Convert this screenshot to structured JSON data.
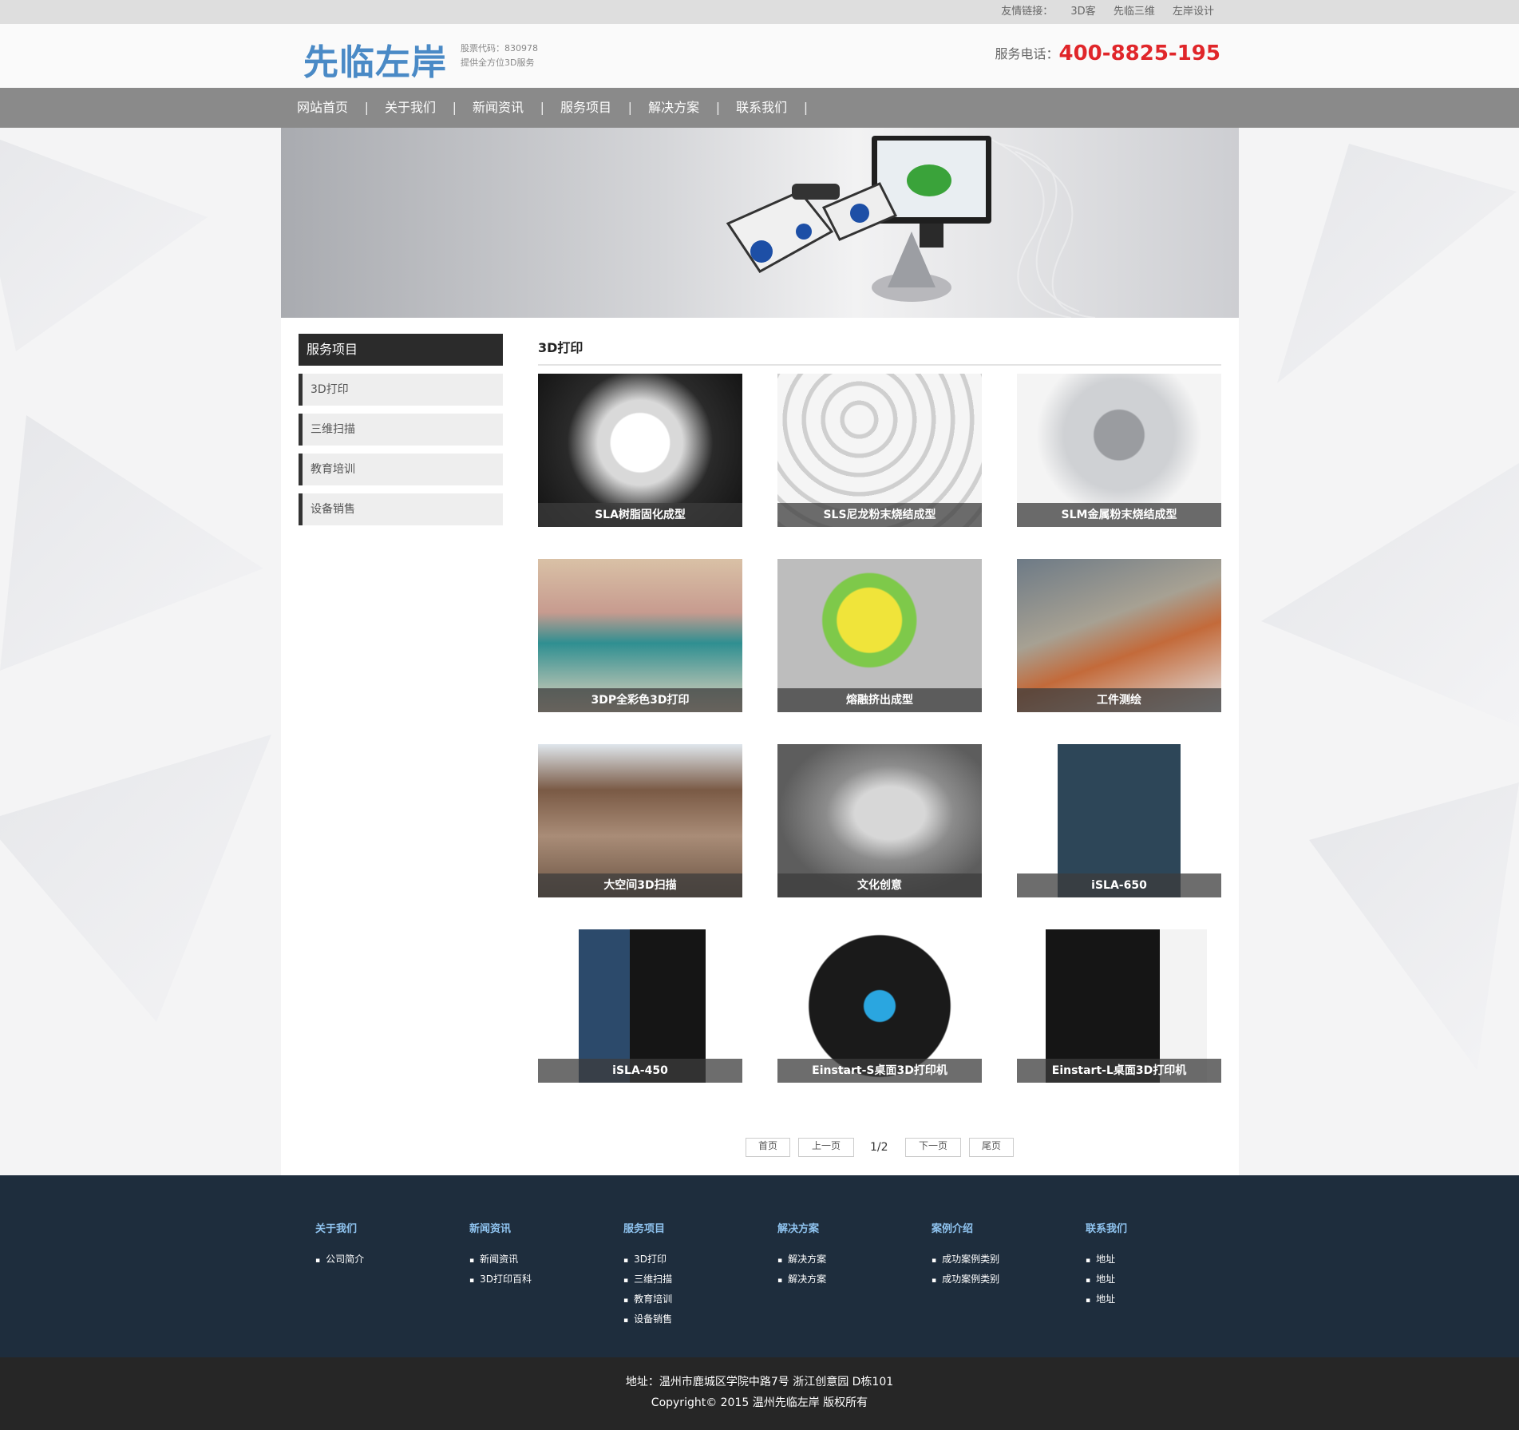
{
  "topbar": {
    "label": "友情链接：",
    "links": [
      "3D客",
      "先临三维",
      "左岸设计"
    ]
  },
  "header": {
    "logo_text": "先临左岸",
    "stock_code": "股票代码：830978",
    "tagline": "提供全方位3D服务",
    "phone_label": "服务电话：",
    "phone_number": "400-8825-195"
  },
  "nav": {
    "items": [
      "网站首页",
      "关于我们",
      "新闻资讯",
      "服务项目",
      "解决方案",
      "联系我们"
    ]
  },
  "sidebar": {
    "title": "服务项目",
    "items": [
      "3D打印",
      "三维扫描",
      "教育培训",
      "设备销售"
    ]
  },
  "main": {
    "title": "3D打印",
    "products": [
      "SLA树脂固化成型",
      "SLS尼龙粉末烧结成型",
      "SLM金属粉末烧结成型",
      "3DP全彩色3D打印",
      "熔融挤出成型",
      "工件测绘",
      "大空间3D扫描",
      "文化创意",
      "iSLA-650",
      "iSLA-450",
      "Einstart-S桌面3D打印机",
      "Einstart-L桌面3D打印机"
    ]
  },
  "pager": {
    "first": "首页",
    "prev": "上一页",
    "current": "1/2",
    "next": "下一页",
    "last": "尾页"
  },
  "footer": {
    "columns": [
      {
        "title": "关于我们",
        "items": [
          "公司简介"
        ]
      },
      {
        "title": "新闻资讯",
        "items": [
          "新闻资讯",
          "3D打印百科"
        ]
      },
      {
        "title": "服务项目",
        "items": [
          "3D打印",
          "三维扫描",
          "教育培训",
          "设备销售"
        ]
      },
      {
        "title": "解决方案",
        "items": [
          "解决方案",
          "解决方案"
        ]
      },
      {
        "title": "案例介绍",
        "items": [
          "成功案例类别",
          "成功案例类别"
        ]
      },
      {
        "title": "联系我们",
        "items": [
          "地址",
          "地址",
          "地址"
        ]
      }
    ],
    "address": "地址：温州市鹿城区学院中路7号 浙江创意园 D栋101",
    "copyright": "Copyright© 2015 温州先临左岸 版权所有"
  },
  "colors": {
    "accent_red": "#e0262a",
    "logo_blue": "#4a8ac6",
    "nav_gray": "#8a8a8a",
    "footer_navy": "#1e2d3d"
  }
}
